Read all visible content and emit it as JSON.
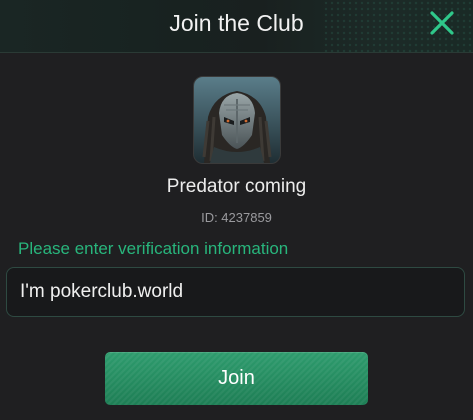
{
  "dialog": {
    "title": "Join the Club",
    "close_icon": "close-x-icon",
    "accent_color": "#28b57c"
  },
  "club": {
    "avatar_icon": "predator-avatar-image",
    "name": "Predator coming",
    "id_text": "ID: 4237859"
  },
  "form": {
    "prompt": "Please enter verification information",
    "input_value": "I'm pokerclub.world"
  },
  "actions": {
    "join_label": "Join"
  }
}
